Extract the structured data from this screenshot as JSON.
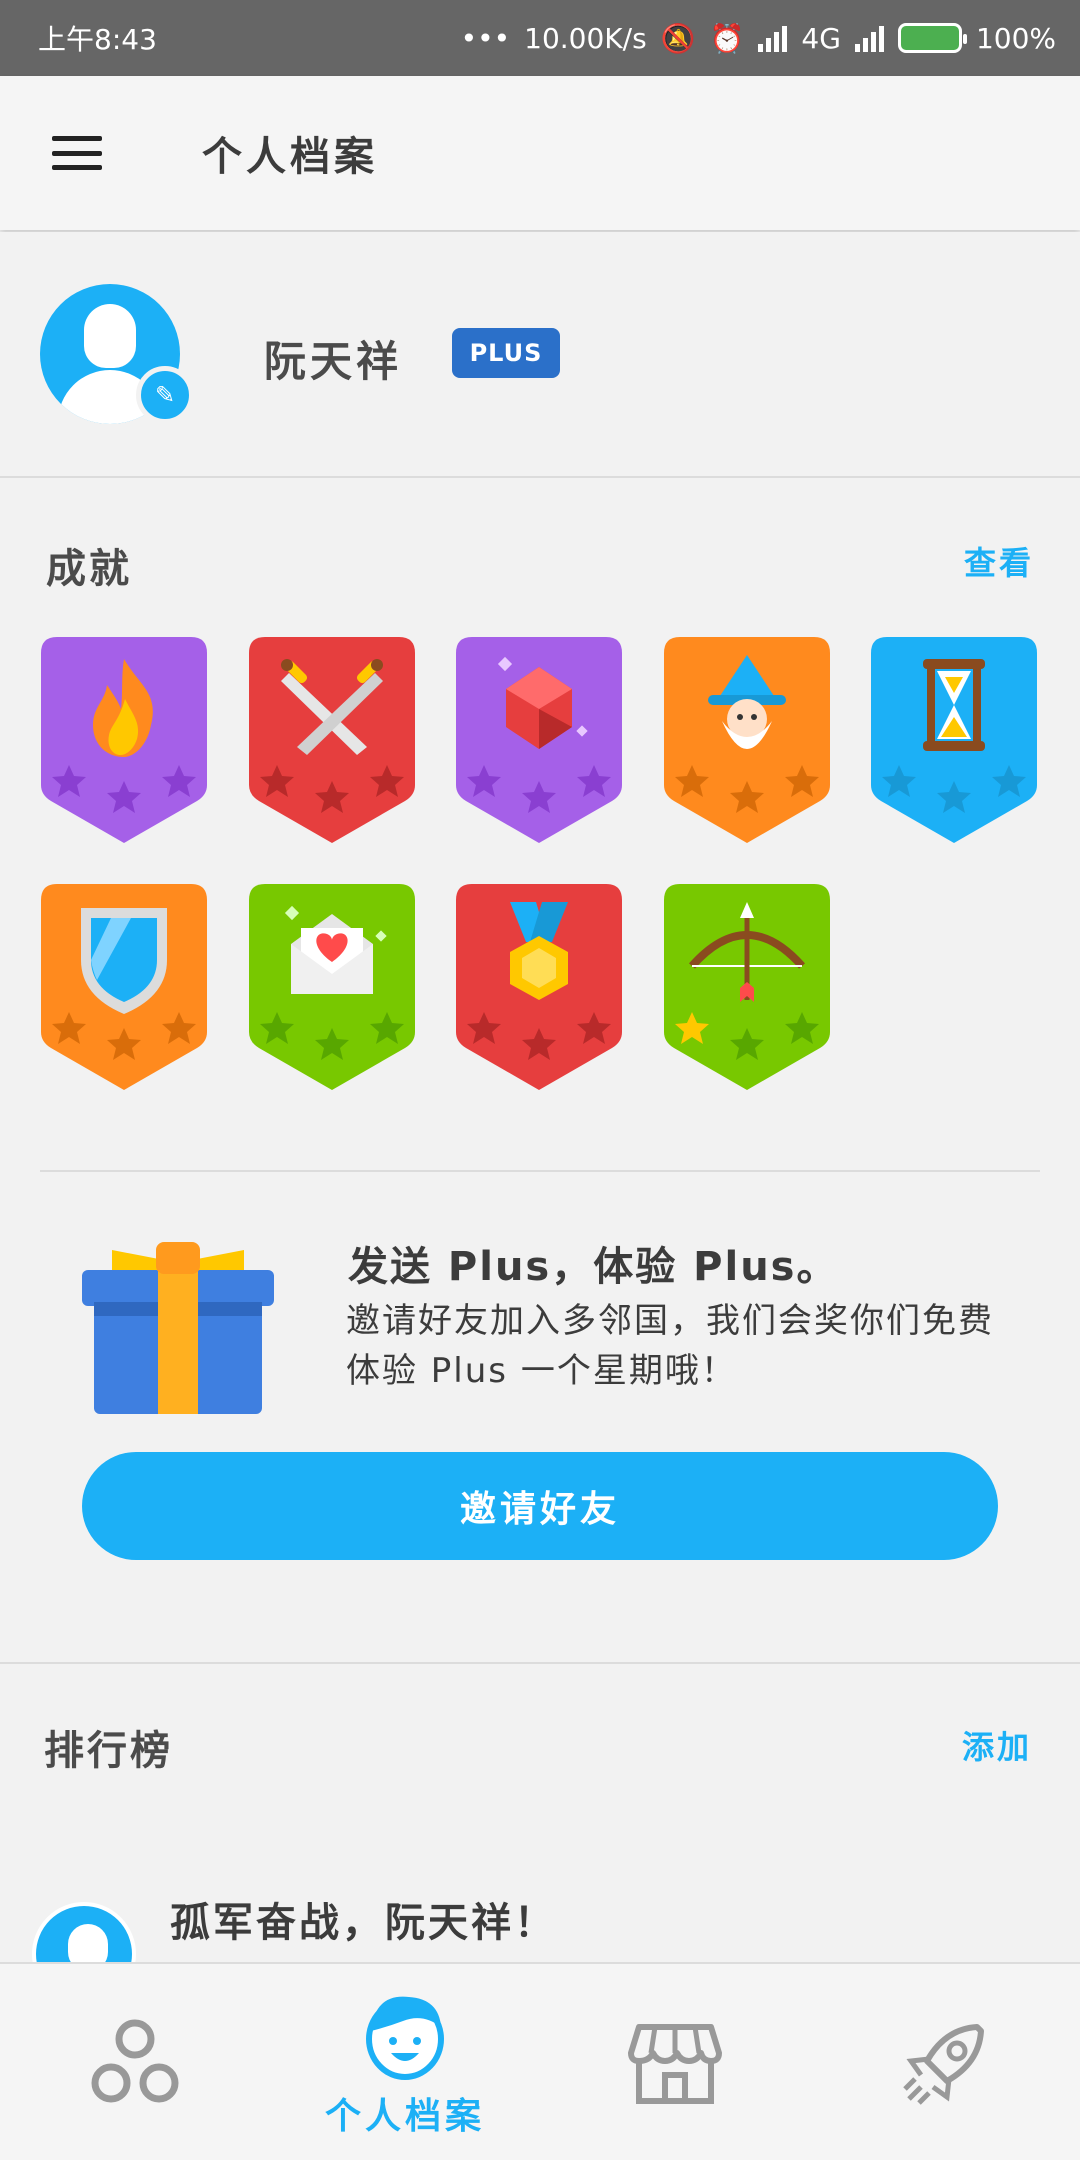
{
  "status_bar": {
    "time": "上午8:43",
    "net_speed": "10.00K/s",
    "network": "4G",
    "battery": "100%"
  },
  "app_bar": {
    "title": "个人档案",
    "menu_icon": "hamburger-menu-icon"
  },
  "profile": {
    "name": "阮天祥",
    "plus_badge": "PLUS",
    "avatar_icon": "user-avatar-icon",
    "edit_icon": "pencil-icon"
  },
  "achievements": {
    "title": "成就",
    "view_link": "查看",
    "badges": [
      {
        "icon": "flame-icon",
        "color": "#a560e8",
        "stars_earned": 0
      },
      {
        "icon": "crossed-swords-icon",
        "color": "#e63e3e",
        "stars_earned": 0
      },
      {
        "icon": "gem-icon",
        "color": "#a560e8",
        "stars_earned": 0
      },
      {
        "icon": "wizard-icon",
        "color": "#ff8a1e",
        "stars_earned": 0
      },
      {
        "icon": "hourglass-icon",
        "color": "#1cb0f6",
        "stars_earned": 0
      },
      {
        "icon": "shield-icon",
        "color": "#ff8a1e",
        "stars_earned": 0
      },
      {
        "icon": "love-letter-icon",
        "color": "#78c800",
        "stars_earned": 0
      },
      {
        "icon": "medal-icon",
        "color": "#e63e3e",
        "stars_earned": 0
      },
      {
        "icon": "bow-arrow-icon",
        "color": "#78c800",
        "stars_earned": 1
      }
    ]
  },
  "promo": {
    "title": "发送 Plus，体验 Plus。",
    "description": "邀请好友加入多邻国，我们会奖你们免费体验 Plus 一个星期哦！",
    "button": "邀请好友",
    "icon": "gift-box-icon"
  },
  "leaderboard": {
    "title": "排行榜",
    "add_link": "添加",
    "message": "孤军奋战，阮天祥！"
  },
  "bottom_nav": {
    "items": [
      {
        "icon": "learn-circles-icon",
        "label": "",
        "active": false
      },
      {
        "icon": "profile-face-icon",
        "label": "个人档案",
        "active": true
      },
      {
        "icon": "shop-icon",
        "label": "",
        "active": false
      },
      {
        "icon": "rocket-icon",
        "label": "",
        "active": false
      }
    ]
  },
  "colors": {
    "accent": "#1cb0f6",
    "plus_badge": "#2b70c9",
    "status_bar": "#666666"
  }
}
